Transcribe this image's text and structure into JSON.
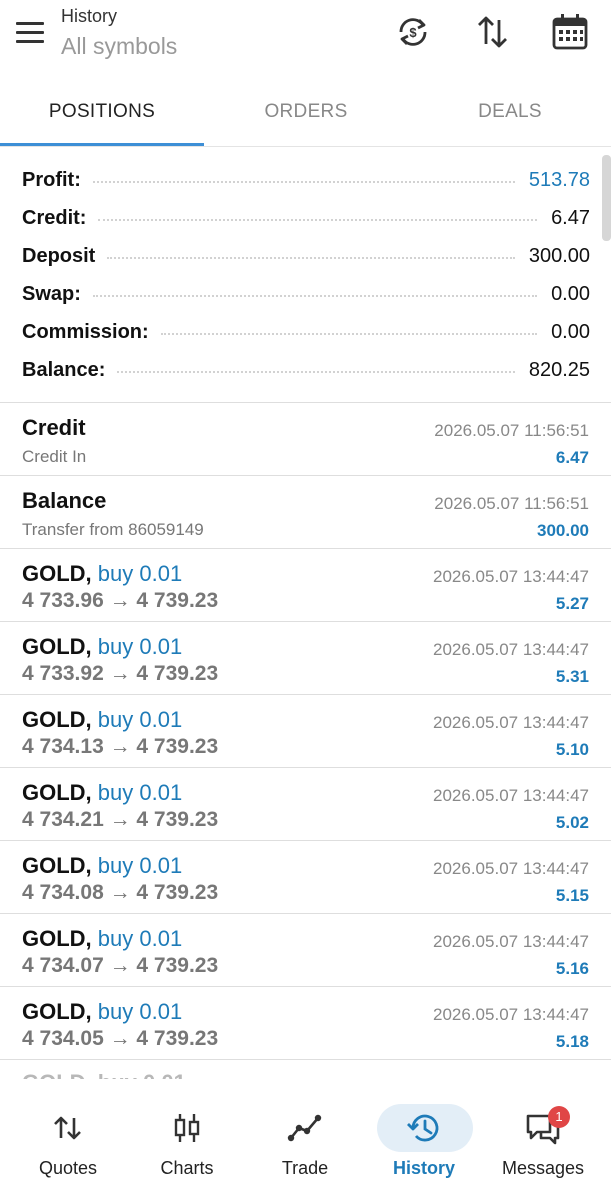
{
  "header": {
    "title": "History",
    "subtitle": "All symbols",
    "icons": [
      "sync-icon",
      "sort-icon",
      "calendar-icon"
    ]
  },
  "tabs": [
    {
      "label": "POSITIONS",
      "active": true
    },
    {
      "label": "ORDERS",
      "active": false
    },
    {
      "label": "DEALS",
      "active": false
    }
  ],
  "summary": [
    {
      "label": "Profit:",
      "value": "513.78",
      "highlight": true
    },
    {
      "label": "Credit:",
      "value": "6.47",
      "highlight": false
    },
    {
      "label": "Deposit",
      "value": "300.00",
      "highlight": false
    },
    {
      "label": "Swap:",
      "value": "0.00",
      "highlight": false
    },
    {
      "label": "Commission:",
      "value": "0.00",
      "highlight": false
    },
    {
      "label": "Balance:",
      "value": "820.25",
      "highlight": false
    }
  ],
  "deals": [
    {
      "title": "Credit",
      "direction": "",
      "subtitle": "Credit In",
      "time": "2026.05.07 11:56:51",
      "profit": "6.47"
    },
    {
      "title": "Balance",
      "direction": "",
      "subtitle": "Transfer from 86059149",
      "time": "2026.05.07 11:56:51",
      "profit": "300.00"
    },
    {
      "title": "GOLD,",
      "direction": "buy 0.01",
      "subtitle": "4 733.96 → 4 739.23",
      "time": "2026.05.07 13:44:47",
      "profit": "5.27"
    },
    {
      "title": "GOLD,",
      "direction": "buy 0.01",
      "subtitle": "4 733.92 → 4 739.23",
      "time": "2026.05.07 13:44:47",
      "profit": "5.31"
    },
    {
      "title": "GOLD,",
      "direction": "buy 0.01",
      "subtitle": "4 734.13 → 4 739.23",
      "time": "2026.05.07 13:44:47",
      "profit": "5.10"
    },
    {
      "title": "GOLD,",
      "direction": "buy 0.01",
      "subtitle": "4 734.21 → 4 739.23",
      "time": "2026.05.07 13:44:47",
      "profit": "5.02"
    },
    {
      "title": "GOLD,",
      "direction": "buy 0.01",
      "subtitle": "4 734.08 → 4 739.23",
      "time": "2026.05.07 13:44:47",
      "profit": "5.15"
    },
    {
      "title": "GOLD,",
      "direction": "buy 0.01",
      "subtitle": "4 734.07 → 4 739.23",
      "time": "2026.05.07 13:44:47",
      "profit": "5.16"
    },
    {
      "title": "GOLD,",
      "direction": "buy 0.01",
      "subtitle": "4 734.05 → 4 739.23",
      "time": "2026.05.07 13:44:47",
      "profit": "5.18"
    }
  ],
  "partial_row": "GOLD, buy 0.01",
  "bottom_nav": [
    {
      "label": "Quotes",
      "icon": "quotes-icon",
      "active": false
    },
    {
      "label": "Charts",
      "icon": "charts-icon",
      "active": false
    },
    {
      "label": "Trade",
      "icon": "trade-icon",
      "active": false
    },
    {
      "label": "History",
      "icon": "history-icon",
      "active": true
    },
    {
      "label": "Messages",
      "icon": "messages-icon",
      "active": false,
      "badge": "1"
    }
  ],
  "colors": {
    "accent": "#1e7bb8",
    "badge": "#e04646"
  }
}
